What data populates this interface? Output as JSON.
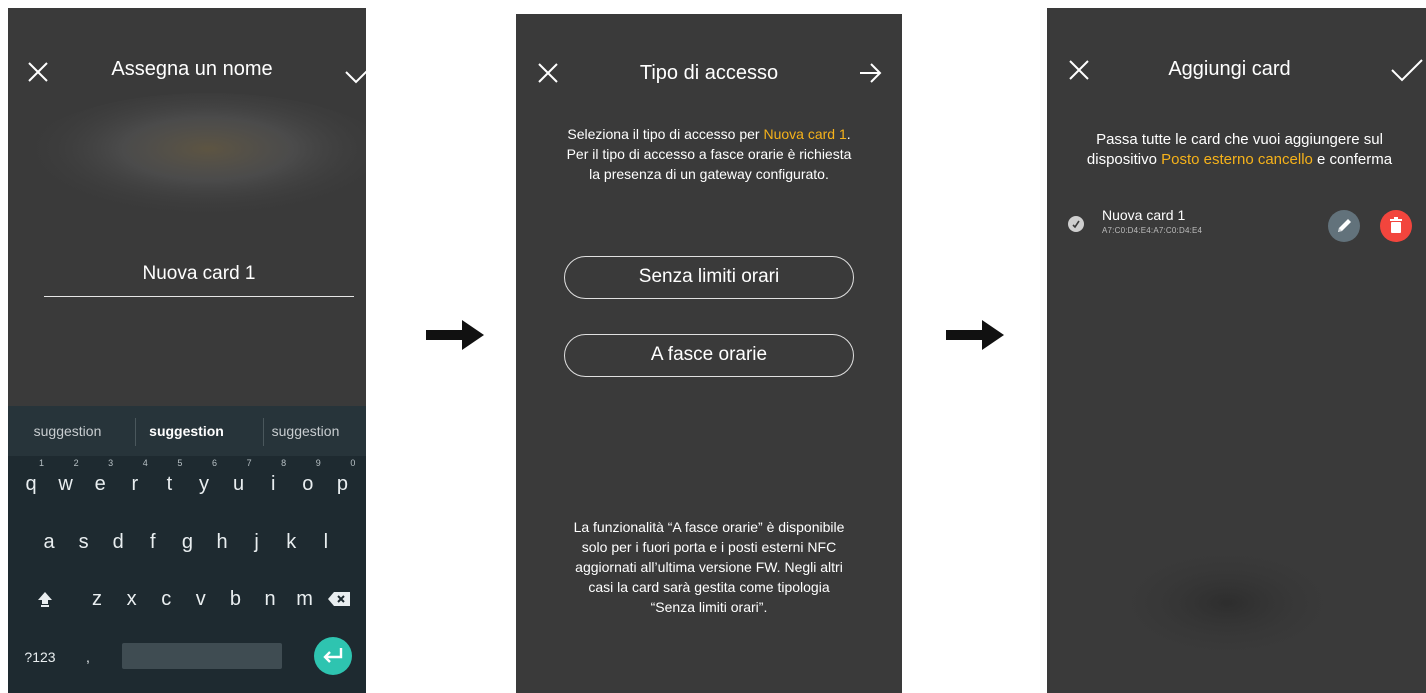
{
  "screen1": {
    "title": "Assegna un nome",
    "name_value": "Nuova card 1",
    "suggestions": [
      "suggestion",
      "suggestion",
      "suggestion"
    ],
    "keyboard": {
      "row1": [
        {
          "k": "q",
          "n": "1"
        },
        {
          "k": "w",
          "n": "2"
        },
        {
          "k": "e",
          "n": "3"
        },
        {
          "k": "r",
          "n": "4"
        },
        {
          "k": "t",
          "n": "5"
        },
        {
          "k": "y",
          "n": "6"
        },
        {
          "k": "u",
          "n": "7"
        },
        {
          "k": "i",
          "n": "8"
        },
        {
          "k": "o",
          "n": "9"
        },
        {
          "k": "p",
          "n": "0"
        }
      ],
      "row2": [
        "a",
        "s",
        "d",
        "f",
        "g",
        "h",
        "j",
        "k",
        "l"
      ],
      "row3": [
        "z",
        "x",
        "c",
        "v",
        "b",
        "n",
        "m"
      ],
      "symbols_label": "?123",
      "comma": ",",
      "period": "."
    }
  },
  "screen2": {
    "title": "Tipo di accesso",
    "desc_pre": "Seleziona il tipo di accesso per ",
    "desc_card": "Nuova card 1",
    "desc_post": ".",
    "desc_line2": "Per il tipo di accesso a fasce orarie è richiesta",
    "desc_line3": "la presenza di un gateway configurato.",
    "option1": "Senza limiti orari",
    "option2": "A fasce orarie",
    "note_lines": [
      "La funzionalità “A fasce orarie” è disponibile",
      "solo per i fuori porta e i posti esterni NFC",
      "aggiornati all’ultima versione FW. Negli altri",
      "casi la card sarà gestita come tipologia",
      "“Senza limiti orari”."
    ]
  },
  "screen3": {
    "title": "Aggiungi card",
    "desc_line1": "Passa tutte le card che vuoi aggiungere sul",
    "desc_pre2": "dispositivo ",
    "desc_device": "Posto esterno cancello",
    "desc_post2": " e conferma",
    "card_name": "Nuova card 1",
    "card_id": "A7:C0:D4:E4:A7:C0:D4:E4"
  },
  "colors": {
    "highlight": "#f6b21a",
    "screen_bg": "#3a3a3a",
    "enter_key": "#2ec4b0",
    "delete_button": "#f2453d",
    "edit_button": "#62727b"
  },
  "icons": {
    "close": "close-icon",
    "confirm": "check-icon",
    "next": "arrow-right-icon",
    "flow_arrow": "arrow-right-icon",
    "edit": "pencil-icon",
    "delete": "trash-icon",
    "card": "card-icon"
  }
}
